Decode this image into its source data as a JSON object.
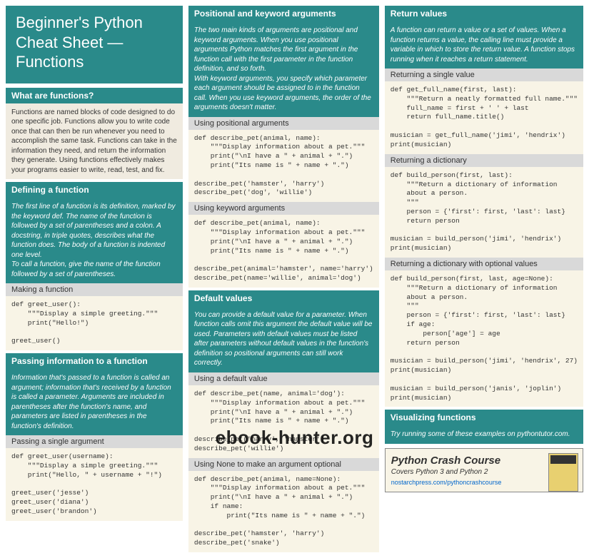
{
  "title": "Beginner's Python\nCheat Sheet —\nFunctions",
  "col1": {
    "s1": {
      "head": "What are functions?",
      "body": "Functions are named blocks of code designed to do one specific job. Functions allow you to write code once that can then be run whenever you need to accomplish the same task. Functions can take in the information they need, and return the information they generate. Using functions effectively makes your programs easier to write, read, test, and fix."
    },
    "s2": {
      "head": "Defining a function",
      "body": "The first line of a function is its definition, marked by the keyword def. The name of the function is followed by a set of parentheses and a colon. A docstring, in triple quotes, describes what the function does. The body of a function is indented one level.\n    To call a function, give the name of the function followed by a set of parentheses.",
      "sub1": "Making a function",
      "code1": "def greet_user():\n    \"\"\"Display a simple greeting.\"\"\"\n    print(\"Hello!\")\n\ngreet_user()"
    },
    "s3": {
      "head": "Passing information to a function",
      "body": "Information that's passed to a function is called an argument; information that's received by a function is called a parameter. Arguments are included in parentheses after the function's name, and parameters are listed in parentheses in the function's definition.",
      "sub1": "Passing a single argument",
      "code1": "def greet_user(username):\n    \"\"\"Display a simple greeting.\"\"\"\n    print(\"Hello, \" + username + \"!\")\n\ngreet_user('jesse')\ngreet_user('diana')\ngreet_user('brandon')"
    }
  },
  "col2": {
    "s1": {
      "head": "Positional and keyword arguments",
      "body": "The two main kinds of arguments are positional and keyword arguments. When you use positional arguments Python matches the first argument in the function call with the first parameter in the function definition, and so forth.\n    With keyword arguments, you specify which parameter each argument should be assigned to in the function call. When you use keyword arguments, the order of the arguments doesn't matter.",
      "sub1": "Using positional arguments",
      "code1": "def describe_pet(animal, name):\n    \"\"\"Display information about a pet.\"\"\"\n    print(\"\\nI have a \" + animal + \".\")\n    print(\"Its name is \" + name + \".\")\n\ndescribe_pet('hamster', 'harry')\ndescribe_pet('dog', 'willie')",
      "sub2": "Using keyword arguments",
      "code2": "def describe_pet(animal, name):\n    \"\"\"Display information about a pet.\"\"\"\n    print(\"\\nI have a \" + animal + \".\")\n    print(\"Its name is \" + name + \".\")\n\ndescribe_pet(animal='hamster', name='harry')\ndescribe_pet(name='willie', animal='dog')"
    },
    "s2": {
      "head": "Default values",
      "body": "You can provide a default value for a parameter. When function calls omit this argument the default value will be used. Parameters with default values must be listed after parameters without default values in the function's definition so positional arguments can still work correctly.",
      "sub1": "Using a default value",
      "code1": "def describe_pet(name, animal='dog'):\n    \"\"\"Display information about a pet.\"\"\"\n    print(\"\\nI have a \" + animal + \".\")\n    print(\"Its name is \" + name + \".\")\n\ndescribe_pet('harry', 'hamster')\ndescribe_pet('willie')",
      "sub2": "Using None to make an argument optional",
      "code2": "def describe_pet(animal, name=None):\n    \"\"\"Display information about a pet.\"\"\"\n    print(\"\\nI have a \" + animal + \".\")\n    if name:\n        print(\"Its name is \" + name + \".\")\n\ndescribe_pet('hamster', 'harry')\ndescribe_pet('snake')"
    }
  },
  "col3": {
    "s1": {
      "head": "Return values",
      "body": "A function can return a value or a set of values. When a function returns a value, the calling line must provide a variable in which to store the return value. A function stops running when it reaches a return statement.",
      "sub1": "Returning a single value",
      "code1": "def get_full_name(first, last):\n    \"\"\"Return a neatly formatted full name.\"\"\"\n    full_name = first + ' ' + last\n    return full_name.title()\n\nmusician = get_full_name('jimi', 'hendrix')\nprint(musician)",
      "sub2": "Returning a dictionary",
      "code2": "def build_person(first, last):\n    \"\"\"Return a dictionary of information\n    about a person.\n    \"\"\"\n    person = {'first': first, 'last': last}\n    return person\n\nmusician = build_person('jimi', 'hendrix')\nprint(musician)",
      "sub3": "Returning a dictionary with optional values",
      "code3": "def build_person(first, last, age=None):\n    \"\"\"Return a dictionary of information\n    about a person.\n    \"\"\"\n    person = {'first': first, 'last': last}\n    if age:\n        person['age'] = age\n    return person\n\nmusician = build_person('jimi', 'hendrix', 27)\nprint(musician)\n\nmusician = build_person('janis', 'joplin')\nprint(musician)"
    },
    "s2": {
      "head": "Visualizing functions",
      "body": "Try running some of these examples on pythontutor.com."
    },
    "book": {
      "title": "Python Crash Course",
      "sub": "Covers Python 3 and Python 2",
      "link": "nostarchpress.com/pythoncrashcourse"
    }
  },
  "watermark": "ebook-hunter.org"
}
